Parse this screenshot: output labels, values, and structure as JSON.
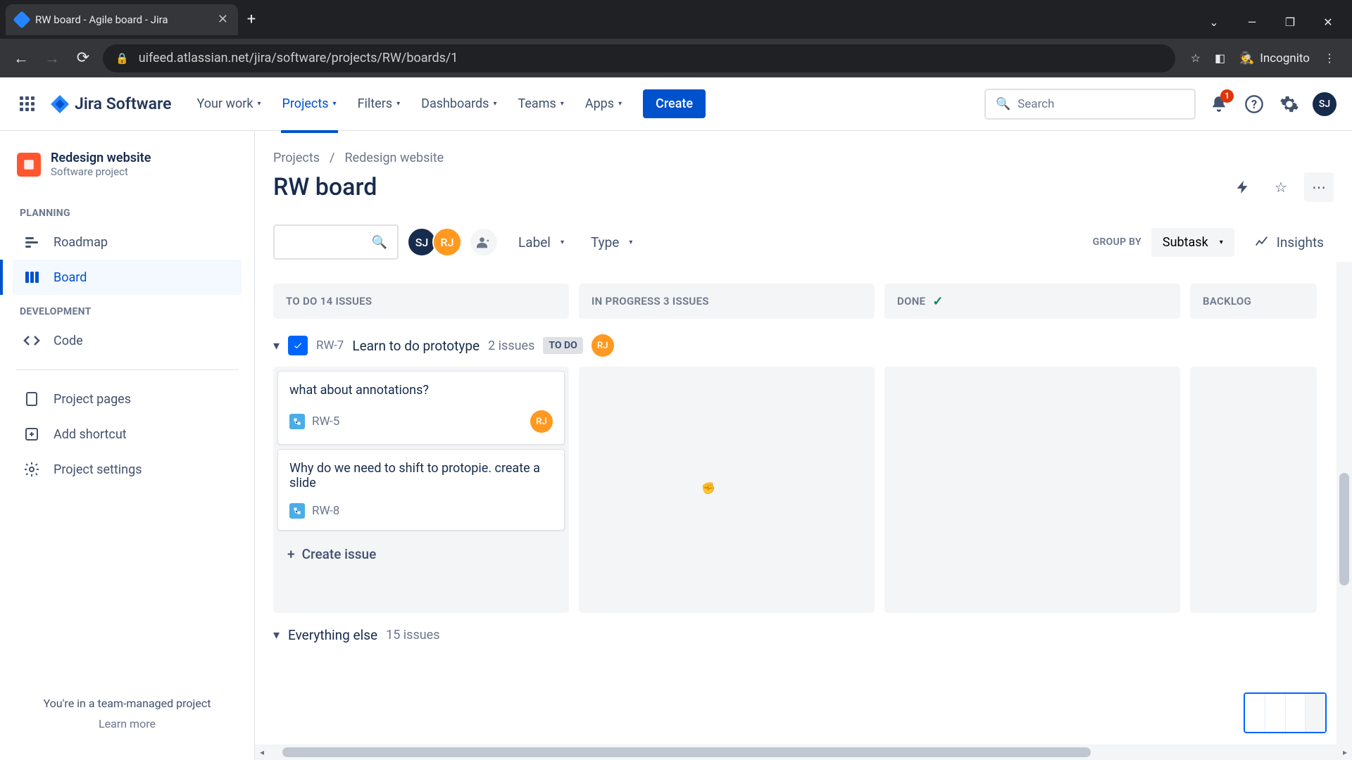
{
  "browser": {
    "tab_title": "RW board - Agile board - Jira",
    "url": "uifeed.atlassian.net/jira/software/projects/RW/boards/1",
    "incognito": "Incognito"
  },
  "header": {
    "logo": "Jira Software",
    "nav": {
      "your_work": "Your work",
      "projects": "Projects",
      "filters": "Filters",
      "dashboards": "Dashboards",
      "teams": "Teams",
      "apps": "Apps"
    },
    "create": "Create",
    "search_placeholder": "Search",
    "notif_count": "1",
    "user_initials": "SJ"
  },
  "sidebar": {
    "project_name": "Redesign website",
    "project_type": "Software project",
    "sections": {
      "planning": "PLANNING",
      "development": "DEVELOPMENT"
    },
    "items": {
      "roadmap": "Roadmap",
      "board": "Board",
      "code": "Code",
      "project_pages": "Project pages",
      "add_shortcut": "Add shortcut",
      "project_settings": "Project settings"
    },
    "footer_text": "You're in a team-managed project",
    "learn_more": "Learn more"
  },
  "breadcrumb": {
    "projects": "Projects",
    "project": "Redesign website"
  },
  "board": {
    "title": "RW board",
    "filters": {
      "label": "Label",
      "type": "Type"
    },
    "avatars": {
      "sj": "SJ",
      "rj": "RJ"
    },
    "group_by_label": "GROUP BY",
    "group_by_value": "Subtask",
    "insights": "Insights",
    "columns": {
      "todo": "TO DO 14 ISSUES",
      "in_progress": "IN PROGRESS 3 ISSUES",
      "done": "DONE",
      "backlog": "BACKLOG"
    },
    "swimlane1": {
      "key": "RW-7",
      "title": "Learn to do prototype",
      "count": "2 issues",
      "status": "TO DO",
      "assignee": "RJ"
    },
    "cards": [
      {
        "title": "what about annotations?",
        "key": "RW-5",
        "assignee": "RJ"
      },
      {
        "title": "Why do we need to shift to protopie. create a slide",
        "key": "RW-8"
      }
    ],
    "create_issue": "Create issue",
    "swimlane2": {
      "title": "Everything else",
      "count": "15 issues"
    }
  }
}
